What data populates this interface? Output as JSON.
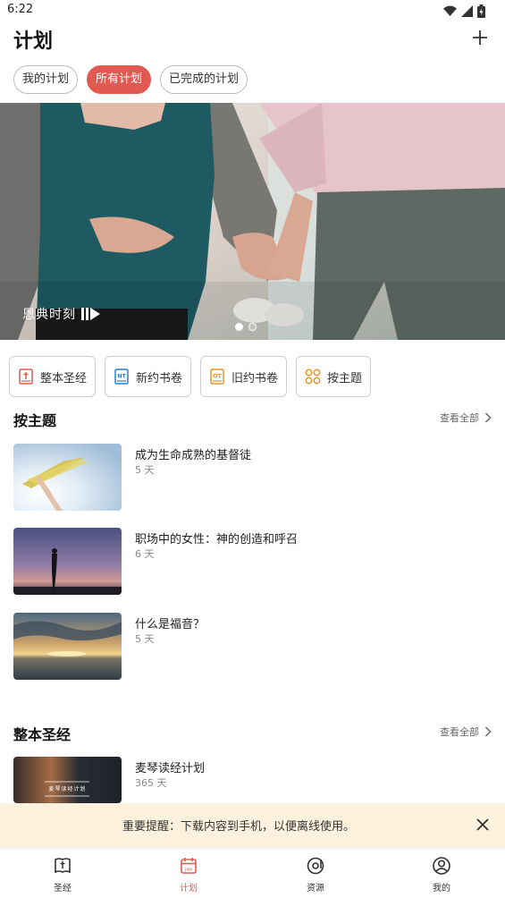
{
  "status_bar": {
    "time": "6:22"
  },
  "header": {
    "title": "计划"
  },
  "filter_chips": [
    {
      "label": "我的计划",
      "active": false
    },
    {
      "label": "所有计划",
      "active": true
    },
    {
      "label": "已完成的计划",
      "active": false
    }
  ],
  "banner": {
    "brand": "恩典时刻",
    "slide_count": 2,
    "active_slide": 1
  },
  "categories": [
    {
      "label": "整本圣经",
      "icon": "bible-icon"
    },
    {
      "label": "新约书卷",
      "icon": "nt-book-icon"
    },
    {
      "label": "旧约书卷",
      "icon": "ot-book-icon"
    },
    {
      "label": "按主题",
      "icon": "grid-circles-icon"
    }
  ],
  "topic_section": {
    "title": "按主题",
    "see_all": "查看全部",
    "plans": [
      {
        "title": "成为生命成熟的基督徒",
        "days": "5 天"
      },
      {
        "title": "职场中的女性：神的创造和呼召",
        "days": "6 天"
      },
      {
        "title": "什么是福音？",
        "days": "5 天"
      }
    ]
  },
  "bible_section": {
    "title": "整本圣经",
    "see_all": "查看全部",
    "plans": [
      {
        "title": "麦琴读经计划",
        "days": "365 天",
        "thumb_text": "麦琴读经计划"
      }
    ]
  },
  "notice": {
    "text": "重要提醒：下载内容到手机，以便离线使用。"
  },
  "tabbar": {
    "tabs": [
      {
        "label": "圣经",
        "icon": "bible-book-icon",
        "active": false
      },
      {
        "label": "计划",
        "icon": "calendar-icon",
        "active": true
      },
      {
        "label": "资源",
        "icon": "music-disc-icon",
        "active": false
      },
      {
        "label": "我的",
        "icon": "user-icon",
        "active": false
      }
    ]
  },
  "colors": {
    "accent": "#e05a52",
    "notice_bg": "#fbf1dc"
  }
}
